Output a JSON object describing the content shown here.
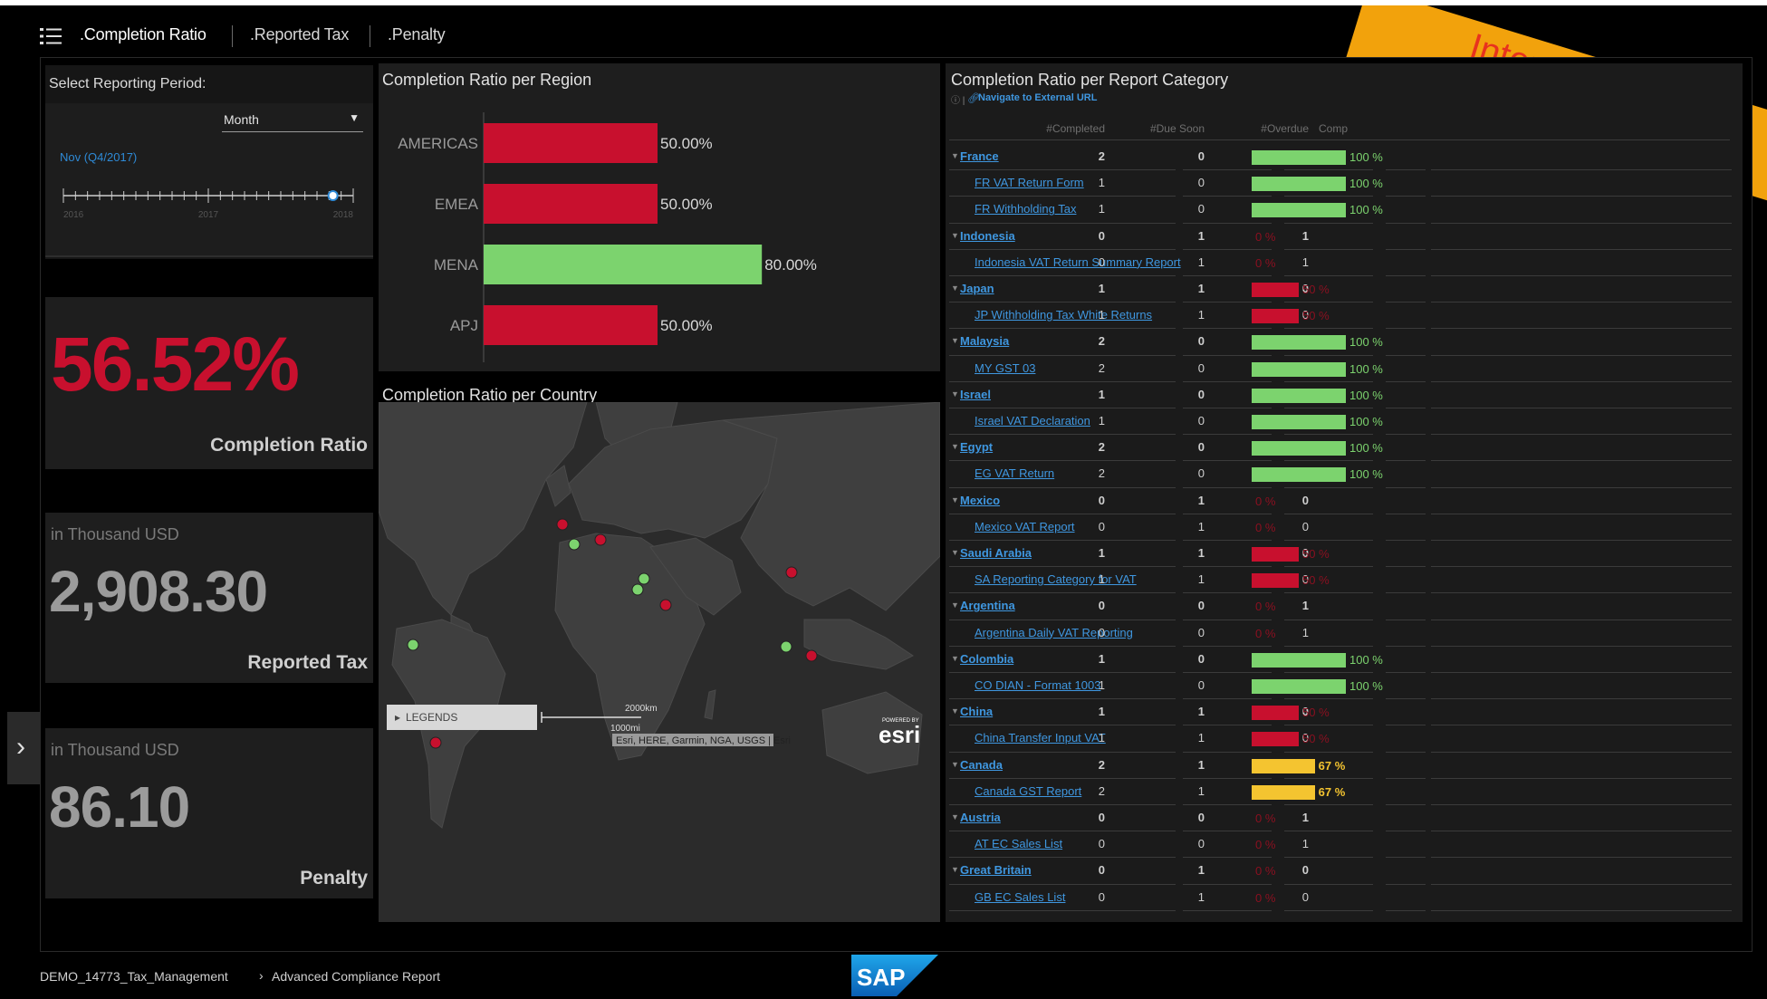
{
  "tabs": [
    {
      "label": ".Completion Ratio",
      "active": true
    },
    {
      "label": ".Reported Tax",
      "active": false
    },
    {
      "label": ".Penalty",
      "active": false
    }
  ],
  "period": {
    "title": "Select Reporting Period:",
    "granularity": "Month",
    "selected": "Nov (Q4/2017)",
    "years": [
      "2016",
      "2017",
      "2018"
    ],
    "position": 0.93
  },
  "kpis": {
    "completion": {
      "value": "56.52%",
      "label": "Completion Ratio"
    },
    "reported_tax": {
      "unit": "in Thousand USD",
      "value": "2,908.30",
      "label": "Reported Tax"
    },
    "penalty": {
      "unit": "in Thousand USD",
      "value": "86.10",
      "label": "Penalty"
    }
  },
  "region_chart": {
    "title": "Completion Ratio per Region",
    "chart_data": {
      "type": "bar",
      "categories": [
        "AMERICAS",
        "EMEA",
        "MENA",
        "APJ"
      ],
      "values": [
        50.0,
        50.0,
        80.0,
        50.0
      ],
      "value_labels": [
        "50.00%",
        "50.00%",
        "80.00%",
        "50.00%"
      ],
      "colors": [
        "#c8102e",
        "#c8102e",
        "#7cd36e",
        "#c8102e"
      ],
      "xlim": [
        0,
        100
      ]
    }
  },
  "map": {
    "title": "Completion Ratio per Country",
    "legends_label": "LEGENDS",
    "scale_km": "2000km",
    "scale_mi": "1000mi",
    "attribution": "Esri, HERE, Garmin, NGA, USGS | Esri",
    "powered_by": "POWERED BY",
    "esri": "esri"
  },
  "category_table": {
    "title": "Completion Ratio per Report Category",
    "nav_link": "Navigate to External URL",
    "headers": [
      "#Completed",
      "#Due Soon",
      "#Overdue",
      "Comp"
    ],
    "rows": [
      {
        "name": "France",
        "level": 0,
        "completed": "2",
        "due": "0",
        "overdue": "0",
        "pct_label": "100 %",
        "ratio": 1.0
      },
      {
        "name": "FR VAT Return Form",
        "level": 1,
        "completed": "1",
        "due": "0",
        "overdue": "0",
        "pct_label": "100 %",
        "ratio": 1.0
      },
      {
        "name": "FR Withholding Tax",
        "level": 1,
        "completed": "1",
        "due": "0",
        "overdue": "0",
        "pct_label": "100 %",
        "ratio": 1.0
      },
      {
        "name": "Indonesia",
        "level": 0,
        "completed": "0",
        "due": "1",
        "overdue": "1",
        "pct_label": "0 %",
        "ratio": 0.0
      },
      {
        "name": "Indonesia VAT Return Summary Report",
        "level": 1,
        "completed": "0",
        "due": "1",
        "overdue": "1",
        "pct_label": "0 %",
        "ratio": 0.0
      },
      {
        "name": "Japan",
        "level": 0,
        "completed": "1",
        "due": "1",
        "overdue": "0",
        "pct_label": "50 %",
        "ratio": 0.5
      },
      {
        "name": "JP Withholding Tax White Returns",
        "level": 1,
        "completed": "1",
        "due": "1",
        "overdue": "0",
        "pct_label": "50 %",
        "ratio": 0.5
      },
      {
        "name": "Malaysia",
        "level": 0,
        "completed": "2",
        "due": "0",
        "overdue": "0",
        "pct_label": "100 %",
        "ratio": 1.0
      },
      {
        "name": "MY GST 03",
        "level": 1,
        "completed": "2",
        "due": "0",
        "overdue": "0",
        "pct_label": "100 %",
        "ratio": 1.0
      },
      {
        "name": "Israel",
        "level": 0,
        "completed": "1",
        "due": "0",
        "overdue": "0",
        "pct_label": "100 %",
        "ratio": 1.0
      },
      {
        "name": "Israel VAT Declaration",
        "level": 1,
        "completed": "1",
        "due": "0",
        "overdue": "0",
        "pct_label": "100 %",
        "ratio": 1.0
      },
      {
        "name": "Egypt",
        "level": 0,
        "completed": "2",
        "due": "0",
        "overdue": "0",
        "pct_label": "100 %",
        "ratio": 1.0
      },
      {
        "name": "EG VAT Return",
        "level": 1,
        "completed": "2",
        "due": "0",
        "overdue": "0",
        "pct_label": "100 %",
        "ratio": 1.0
      },
      {
        "name": "Mexico",
        "level": 0,
        "completed": "0",
        "due": "1",
        "overdue": "0",
        "pct_label": "0 %",
        "ratio": 0.0
      },
      {
        "name": "Mexico VAT Report",
        "level": 1,
        "completed": "0",
        "due": "1",
        "overdue": "0",
        "pct_label": "0 %",
        "ratio": 0.0
      },
      {
        "name": "Saudi Arabia",
        "level": 0,
        "completed": "1",
        "due": "1",
        "overdue": "0",
        "pct_label": "50 %",
        "ratio": 0.5
      },
      {
        "name": "SA Reporting Category for VAT",
        "level": 1,
        "completed": "1",
        "due": "1",
        "overdue": "0",
        "pct_label": "50 %",
        "ratio": 0.5
      },
      {
        "name": "Argentina",
        "level": 0,
        "completed": "0",
        "due": "0",
        "overdue": "1",
        "pct_label": "0 %",
        "ratio": 0.0
      },
      {
        "name": "Argentina Daily VAT Reporting",
        "level": 1,
        "completed": "0",
        "due": "0",
        "overdue": "1",
        "pct_label": "0 %",
        "ratio": 0.0
      },
      {
        "name": "Colombia",
        "level": 0,
        "completed": "1",
        "due": "0",
        "overdue": "0",
        "pct_label": "100 %",
        "ratio": 1.0
      },
      {
        "name": "CO DIAN - Format 1003",
        "level": 1,
        "completed": "1",
        "due": "0",
        "overdue": "0",
        "pct_label": "100 %",
        "ratio": 1.0
      },
      {
        "name": "China",
        "level": 0,
        "completed": "1",
        "due": "1",
        "overdue": "0",
        "pct_label": "50 %",
        "ratio": 0.5
      },
      {
        "name": "China Transfer Input VAT",
        "level": 1,
        "completed": "1",
        "due": "1",
        "overdue": "0",
        "pct_label": "50 %",
        "ratio": 0.5
      },
      {
        "name": "Canada",
        "level": 0,
        "completed": "2",
        "due": "1",
        "overdue": "0",
        "pct_label": "67 %",
        "ratio": 0.67
      },
      {
        "name": "Canada GST Report",
        "level": 1,
        "completed": "2",
        "due": "1",
        "overdue": "0",
        "pct_label": "67 %",
        "ratio": 0.67
      },
      {
        "name": "Austria",
        "level": 0,
        "completed": "0",
        "due": "0",
        "overdue": "1",
        "pct_label": "0 %",
        "ratio": 0.0
      },
      {
        "name": "AT EC Sales List",
        "level": 1,
        "completed": "0",
        "due": "0",
        "overdue": "1",
        "pct_label": "0 %",
        "ratio": 0.0
      },
      {
        "name": "Great Britain",
        "level": 0,
        "completed": "0",
        "due": "1",
        "overdue": "0",
        "pct_label": "0 %",
        "ratio": 0.0
      },
      {
        "name": "GB EC Sales List",
        "level": 1,
        "completed": "0",
        "due": "1",
        "overdue": "0",
        "pct_label": "0 %",
        "ratio": 0.0
      }
    ]
  },
  "footer": {
    "crumb_root": "DEMO_14773_Tax_Management",
    "crumb_sep": "›",
    "crumb_page": "Advanced Compliance Report",
    "logo": "SAP"
  },
  "banner": "Internal Lab pre",
  "side_toggle": "›",
  "colors": {
    "red": "#c8102e",
    "green": "#7cd36e",
    "yellow": "#f4c430",
    "link": "#3f97e0",
    "banner": "#f2a20c"
  }
}
